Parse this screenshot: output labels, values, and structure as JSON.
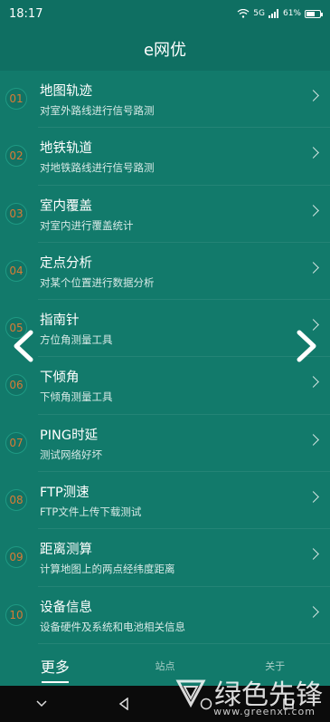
{
  "status_bar": {
    "time": "18:17",
    "signal_label": "5G",
    "battery": "61%",
    "battery_level": 0.61
  },
  "app_bar": {
    "title": "e网优"
  },
  "items": [
    {
      "num": "01",
      "title": "地图轨迹",
      "subtitle": "对室外路线进行信号路测"
    },
    {
      "num": "02",
      "title": "地铁轨道",
      "subtitle": "对地铁路线进行信号路测"
    },
    {
      "num": "03",
      "title": "室内覆盖",
      "subtitle": "对室内进行覆盖统计"
    },
    {
      "num": "04",
      "title": "定点分析",
      "subtitle": "对某个位置进行数据分析"
    },
    {
      "num": "05",
      "title": "指南针",
      "subtitle": "方位角测量工具"
    },
    {
      "num": "06",
      "title": "下倾角",
      "subtitle": "下倾角测量工具"
    },
    {
      "num": "07",
      "title": "PING时延",
      "subtitle": "测试网络好坏"
    },
    {
      "num": "08",
      "title": "FTP测速",
      "subtitle": "FTP文件上传下载测试"
    },
    {
      "num": "09",
      "title": "距离测算",
      "subtitle": "计算地图上的两点经纬度距离"
    },
    {
      "num": "10",
      "title": "设备信息",
      "subtitle": "设备硬件及系统和电池相关信息"
    }
  ],
  "tabs": [
    {
      "label": "更多"
    },
    {
      "label": "站点"
    },
    {
      "label": "关于"
    }
  ],
  "watermark": {
    "brand": "绿色先锋",
    "site": "www.greenxf.com"
  },
  "colors": {
    "background": "#127a6b",
    "header": "#0f6f62",
    "number": "#d87b35"
  }
}
